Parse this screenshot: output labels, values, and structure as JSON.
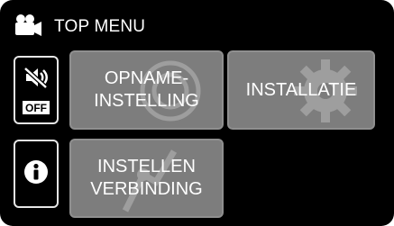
{
  "header": {
    "title": "TOP MENU",
    "icon": "camcorder-icon"
  },
  "side": {
    "mute_button": {
      "icon": "speaker-muted-icon",
      "badge": "OFF"
    },
    "info_button": {
      "icon": "info-icon"
    }
  },
  "menu": {
    "items": [
      {
        "line1": "OPNAME-",
        "line2": "INSTELLING",
        "icon": "record-disc-icon"
      },
      {
        "line1": "INSTALLATIE",
        "icon": "gear-icon"
      },
      {
        "line1": "INSTELLEN",
        "line2": "VERBINDING",
        "icon": "connection-icon"
      }
    ]
  },
  "colors": {
    "screen_bg": "#000000",
    "button_bg": "#7d7d7d",
    "text": "#ffffff"
  }
}
